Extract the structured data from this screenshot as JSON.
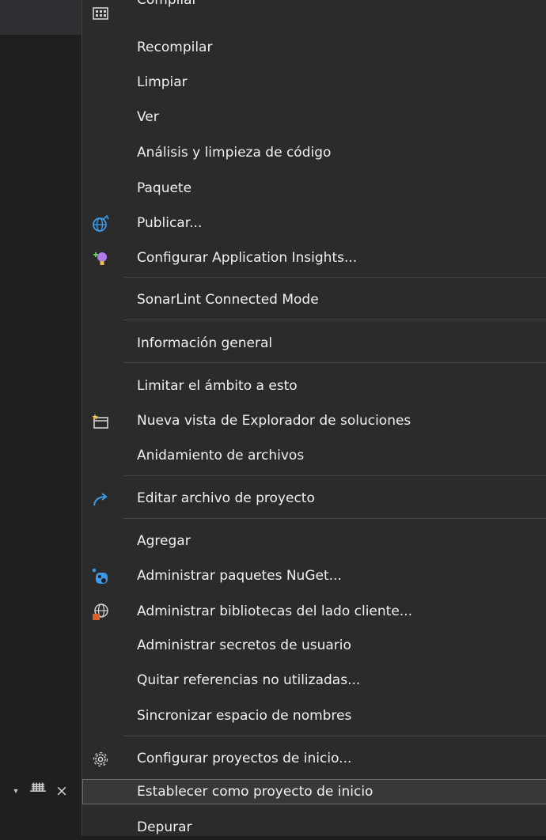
{
  "left_panel": {
    "pane_controls": {
      "dropdown": "▾",
      "pin": "ᚙ",
      "close": "×"
    }
  },
  "menu": {
    "items": [
      {
        "label": "Compilar",
        "icon": "build-icon"
      },
      {
        "label": "Recompilar"
      },
      {
        "label": "Limpiar"
      },
      {
        "label": "Ver"
      },
      {
        "label": "Análisis y limpieza de código"
      },
      {
        "label": "Paquete"
      },
      {
        "label": "Publicar...",
        "icon": "globe-publish-icon"
      },
      {
        "label": "Configurar Application Insights...",
        "icon": "lightbulb-icon"
      },
      {
        "label": "SonarLint Connected Mode"
      },
      {
        "label": "Información general"
      },
      {
        "label": "Limitar el ámbito a esto"
      },
      {
        "label": "Nueva vista de Explorador de soluciones",
        "icon": "new-window-icon"
      },
      {
        "label": "Anidamiento de archivos"
      },
      {
        "label": "Editar archivo de proyecto",
        "icon": "redo-arrow-icon"
      },
      {
        "label": "Agregar"
      },
      {
        "label": "Administrar paquetes NuGet...",
        "icon": "nuget-icon"
      },
      {
        "label": "Administrar bibliotecas del lado cliente...",
        "icon": "client-library-icon"
      },
      {
        "label": "Administrar secretos de usuario"
      },
      {
        "label": "Quitar referencias no utilizadas..."
      },
      {
        "label": "Sincronizar espacio de nombres"
      },
      {
        "label": "Configurar proyectos de inicio...",
        "icon": "gear-icon"
      },
      {
        "label": "Establecer como proyecto de inicio",
        "highlighted": true
      },
      {
        "label": "Depurar"
      }
    ]
  },
  "colors": {
    "menu_bg": "#2b2b2b",
    "text": "#f0f0f0",
    "separator": "#454545",
    "highlight_border": "#6c6c6c",
    "accent_blue": "#3c9ae8"
  }
}
